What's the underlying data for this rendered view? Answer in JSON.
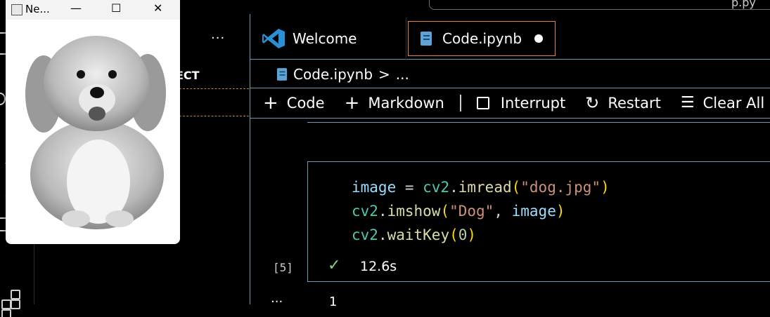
{
  "titlebar": {
    "search_text": "p.py"
  },
  "sidebar": {
    "more_label": "···",
    "project_title": "ECT"
  },
  "tabs": [
    {
      "label": "Welcome"
    },
    {
      "label": "Code.ipynb"
    }
  ],
  "breadcrumb": {
    "file": "Code.ipynb",
    "separator": ">",
    "more": "..."
  },
  "toolbar": {
    "code_label": "Code",
    "markdown_label": "Markdown",
    "interrupt_label": "Interrupt",
    "restart_label": "Restart",
    "clear_label": "Clear All"
  },
  "cell": {
    "lines": [
      "image = cv2.imread(\"dog.jpg\")",
      "cv2.imshow(\"Dog\", image)",
      "cv2.waitKey(0)"
    ],
    "execution_count": "[5]",
    "duration": "12.6s",
    "status_icon": "check-icon"
  },
  "footer": {
    "dots": "···",
    "cell_number": "1"
  },
  "image_window": {
    "title": "Ne...",
    "minimize": "—",
    "maximize": "☐",
    "close": "✕"
  },
  "colors": {
    "accent_border": "#6b9bb6",
    "active_tab_border": "#e8833a",
    "success": "#89d185",
    "vscode_blue": "#2b8fd8"
  }
}
